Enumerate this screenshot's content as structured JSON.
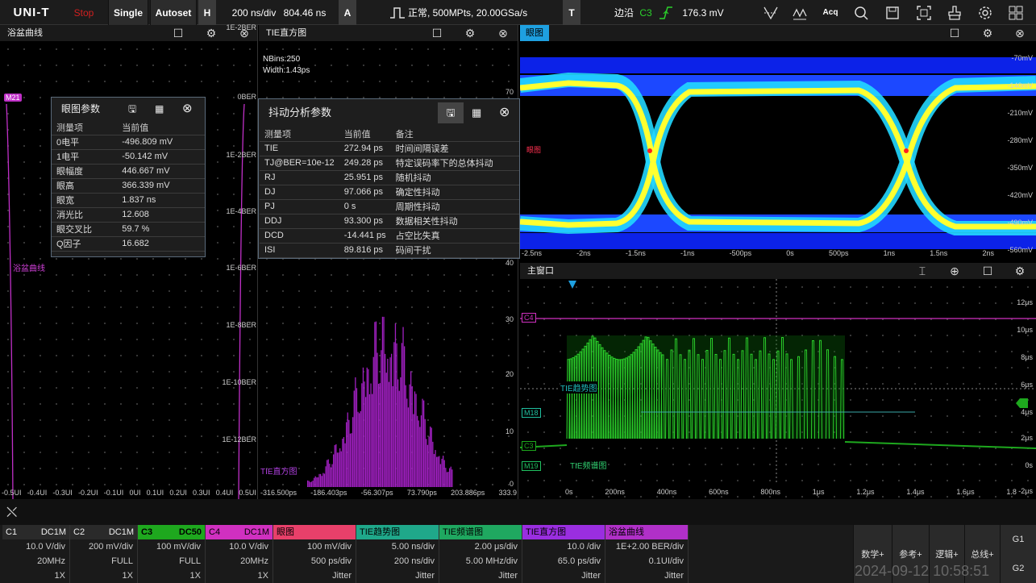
{
  "toolbar": {
    "logo": "UNI-T",
    "stop": "Stop",
    "single": "Single",
    "autoset": "Autoset",
    "h": "H",
    "timebase": "200 ns/div",
    "offset": "804.46 ns",
    "a": "A",
    "acq_status": "正常, 500MPts, 20.00GSa/s",
    "t": "T",
    "trig_mode": "边沿",
    "trig_src": "C3",
    "trig_level": "176.3 mV",
    "acq": "Acq"
  },
  "bathtub": {
    "title": "浴盆曲线",
    "marker": "M21",
    "label": "浴盆曲线",
    "ber_labels": [
      "1E-2BER",
      "0BER",
      "1E-2BER",
      "1E-4BER",
      "1E-6BER",
      "1E-8BER",
      "1E-10BER",
      "1E-12BER"
    ],
    "x_labels": [
      "-0.5UI",
      "-0.4UI",
      "-0.3UI",
      "-0.2UI",
      "-0.1UI",
      "0UI",
      "0.1UI",
      "0.2UI",
      "0.3UI",
      "0.4UI",
      "0.5UI"
    ]
  },
  "eye_params": {
    "title": "眼图参数",
    "headers": [
      "测量项",
      "当前值"
    ],
    "rows": [
      [
        "0电平",
        "-496.809 mV"
      ],
      [
        "1电平",
        "-50.142 mV"
      ],
      [
        "眼幅度",
        "446.667 mV"
      ],
      [
        "眼高",
        "366.339 mV"
      ],
      [
        "眼宽",
        "1.837 ns"
      ],
      [
        "消光比",
        "12.608"
      ],
      [
        "眼交叉比",
        "59.7 %"
      ],
      [
        "Q因子",
        "16.682"
      ]
    ]
  },
  "histogram": {
    "title": "TIE直方图",
    "nbins": "NBins:250",
    "width": "Width:1.43ps",
    "label": "TIE直方图",
    "y_labels": [
      "70",
      "30",
      "20",
      "10",
      "0",
      "40"
    ],
    "x_labels": [
      "-316.500ps",
      "-186.403ps",
      "-56.307ps",
      "73.790ps",
      "203.886ps",
      "333.9"
    ]
  },
  "jitter": {
    "title": "抖动分析参数",
    "headers": [
      "测量项",
      "当前值",
      "备注"
    ],
    "rows": [
      [
        "TIE",
        "272.94 ps",
        "时间间隔误差"
      ],
      [
        "TJ@BER=10e-12",
        "249.28 ps",
        "特定误码率下的总体抖动"
      ],
      [
        "RJ",
        "25.951 ps",
        "随机抖动"
      ],
      [
        "DJ",
        "97.066 ps",
        "确定性抖动"
      ],
      [
        "PJ",
        "0 s",
        "周期性抖动"
      ],
      [
        "DDJ",
        "93.300 ps",
        "数据相关性抖动"
      ],
      [
        "DCD",
        "-14.441 ps",
        "占空比失真"
      ],
      [
        "ISI",
        "89.816 ps",
        "码间干扰"
      ]
    ]
  },
  "eye": {
    "title": "眼图",
    "label": "眼图",
    "y_labels": [
      "-70mV",
      "-140mV",
      "-210mV",
      "-280mV",
      "-350mV",
      "-420mV",
      "-490mV",
      "-560mV"
    ],
    "x_labels": [
      "-2.5ns",
      "-2ns",
      "-1.5ns",
      "-1ns",
      "-500ps",
      "0s",
      "500ps",
      "1ns",
      "1.5ns",
      "2ns",
      "2.5"
    ]
  },
  "main": {
    "title": "主窗口",
    "markers": {
      "c4": "C4",
      "m18": "M18",
      "c3": "C3",
      "m19": "M19"
    },
    "tie_trend": "TIE趋势图",
    "tie_spectrum": "TIE频谱图",
    "y_labels": [
      "12μs",
      "10μs",
      "8μs",
      "6μs",
      "4μs",
      "2μs",
      "0s",
      "-2μs"
    ],
    "x_labels": [
      "0s",
      "200ns",
      "400ns",
      "600ns",
      "800ns",
      "1μs",
      "1.2μs",
      "1.4μs",
      "1.6μs",
      "1.8"
    ]
  },
  "channels": [
    {
      "name": "C1",
      "coupling": "DC1M",
      "scale": "10.0 V/div",
      "bw": "20MHz",
      "probe": "1X",
      "color": "#2a2a2a",
      "text": "#eee"
    },
    {
      "name": "C2",
      "coupling": "DC1M",
      "scale": "200 mV/div",
      "bw": "FULL",
      "probe": "1X",
      "color": "#2a2a2a",
      "text": "#eee"
    },
    {
      "name": "C3",
      "coupling": "DC50",
      "scale": "100 mV/div",
      "bw": "FULL",
      "probe": "1X",
      "color": "#1ea81e",
      "text": "#000"
    },
    {
      "name": "C4",
      "coupling": "DC1M",
      "scale": "10.0 V/div",
      "bw": "20MHz",
      "probe": "1X",
      "color": "#d030c0",
      "text": "#000"
    }
  ],
  "math": [
    {
      "name": "眼图",
      "l1": "100 mV/div",
      "l2": "500 ps/div",
      "l3": "Jitter",
      "color": "#e8406a"
    },
    {
      "name": "TIE趋势图",
      "l1": "5.00 ns/div",
      "l2": "200 ns/div",
      "l3": "Jitter",
      "color": "#1fa88a"
    },
    {
      "name": "TIE频谱图",
      "l1": "2.00 μs/div",
      "l2": "5.00 MHz/div",
      "l3": "Jitter",
      "color": "#1fa860"
    },
    {
      "name": "TIE直方图",
      "l1": "10.0  /div",
      "l2": "65.0 ps/div",
      "l3": "Jitter",
      "color": "#9a2ee0"
    },
    {
      "name": "浴盆曲线",
      "l1": "1E+2.00 BER/div",
      "l2": "0.1UI/div",
      "l3": "Jitter",
      "color": "#b030c8"
    }
  ],
  "menus": {
    "math": "数学+",
    "ref": "参考+",
    "logic": "逻辑+",
    "bus": "总线+",
    "g1": "G1",
    "g2": "G2"
  },
  "datetime": "2024-09-12 10:58:51"
}
